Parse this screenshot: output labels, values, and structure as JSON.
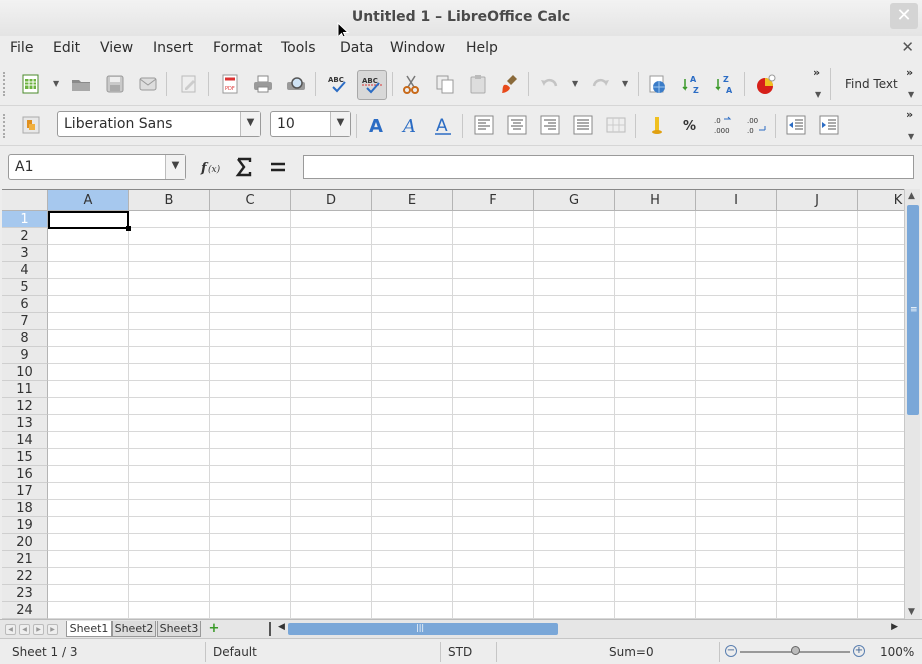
{
  "window": {
    "title": "Untitled 1 – LibreOffice Calc",
    "close_glyph": "✕"
  },
  "menu": {
    "items": [
      "File",
      "Edit",
      "View",
      "Insert",
      "Format",
      "Tools",
      "Data",
      "Window",
      "Help"
    ],
    "close_doc_glyph": "✕"
  },
  "toolbar": {
    "find_text_label": "Find Text",
    "more_glyph": "»"
  },
  "formatting": {
    "font_name": "Liberation Sans",
    "font_size": "10"
  },
  "formula_bar": {
    "name_box_value": "A1",
    "formula_value": ""
  },
  "grid": {
    "columns": [
      "A",
      "B",
      "C",
      "D",
      "E",
      "F",
      "G",
      "H",
      "I",
      "J",
      "K"
    ],
    "rows": [
      "1",
      "2",
      "3",
      "4",
      "5",
      "6",
      "7",
      "8",
      "9",
      "10",
      "11",
      "12",
      "13",
      "14",
      "15",
      "16",
      "17",
      "18",
      "19",
      "20",
      "21",
      "22",
      "23",
      "24"
    ],
    "selected_column": "A",
    "selected_row": "1"
  },
  "sheets": {
    "tabs": [
      "Sheet1",
      "Sheet2",
      "Sheet3"
    ],
    "active": "Sheet1",
    "add_glyph": "+"
  },
  "status": {
    "sheet_position": "Sheet 1 / 3",
    "page_style": "Default",
    "selection_mode": "STD",
    "sum": "Sum=0",
    "zoom": "100%"
  },
  "colors": {
    "selection_header": "#a6c8ee",
    "scroll_thumb": "#7aa7d8"
  }
}
